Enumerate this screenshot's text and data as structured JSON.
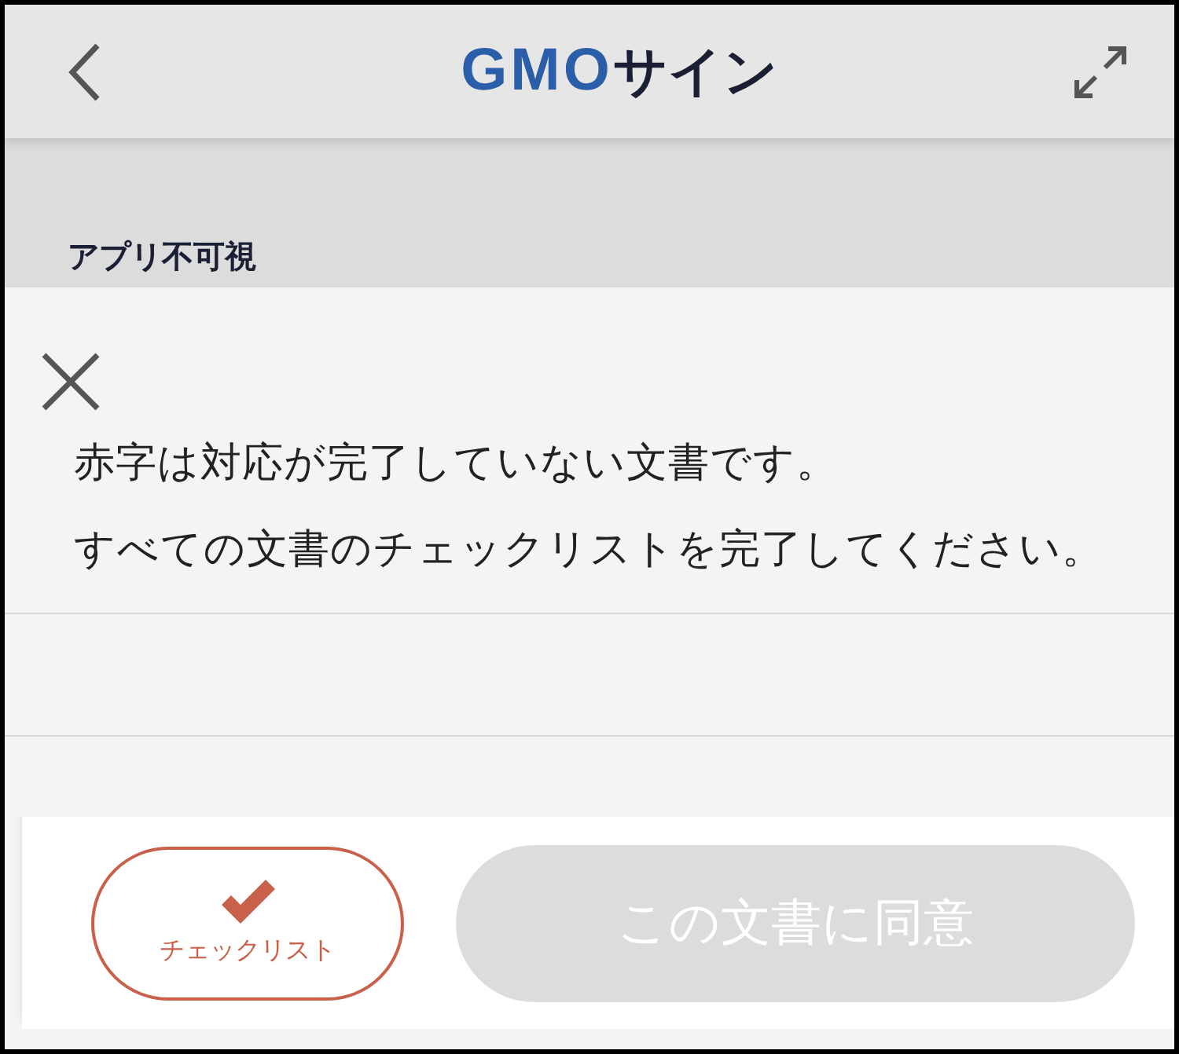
{
  "header": {
    "logo": {
      "brand": "GMO",
      "product": "サイン"
    }
  },
  "background": {
    "section_title": "アプリ不可視"
  },
  "notice": {
    "lines": [
      "赤字は対応が完了していない文書です。",
      "すべての文書のチェックリストを完了してください。"
    ]
  },
  "footer": {
    "checklist_button": {
      "label": "チェックリスト"
    },
    "agree_button": {
      "label": "この文書に同意",
      "disabled": true
    }
  }
}
